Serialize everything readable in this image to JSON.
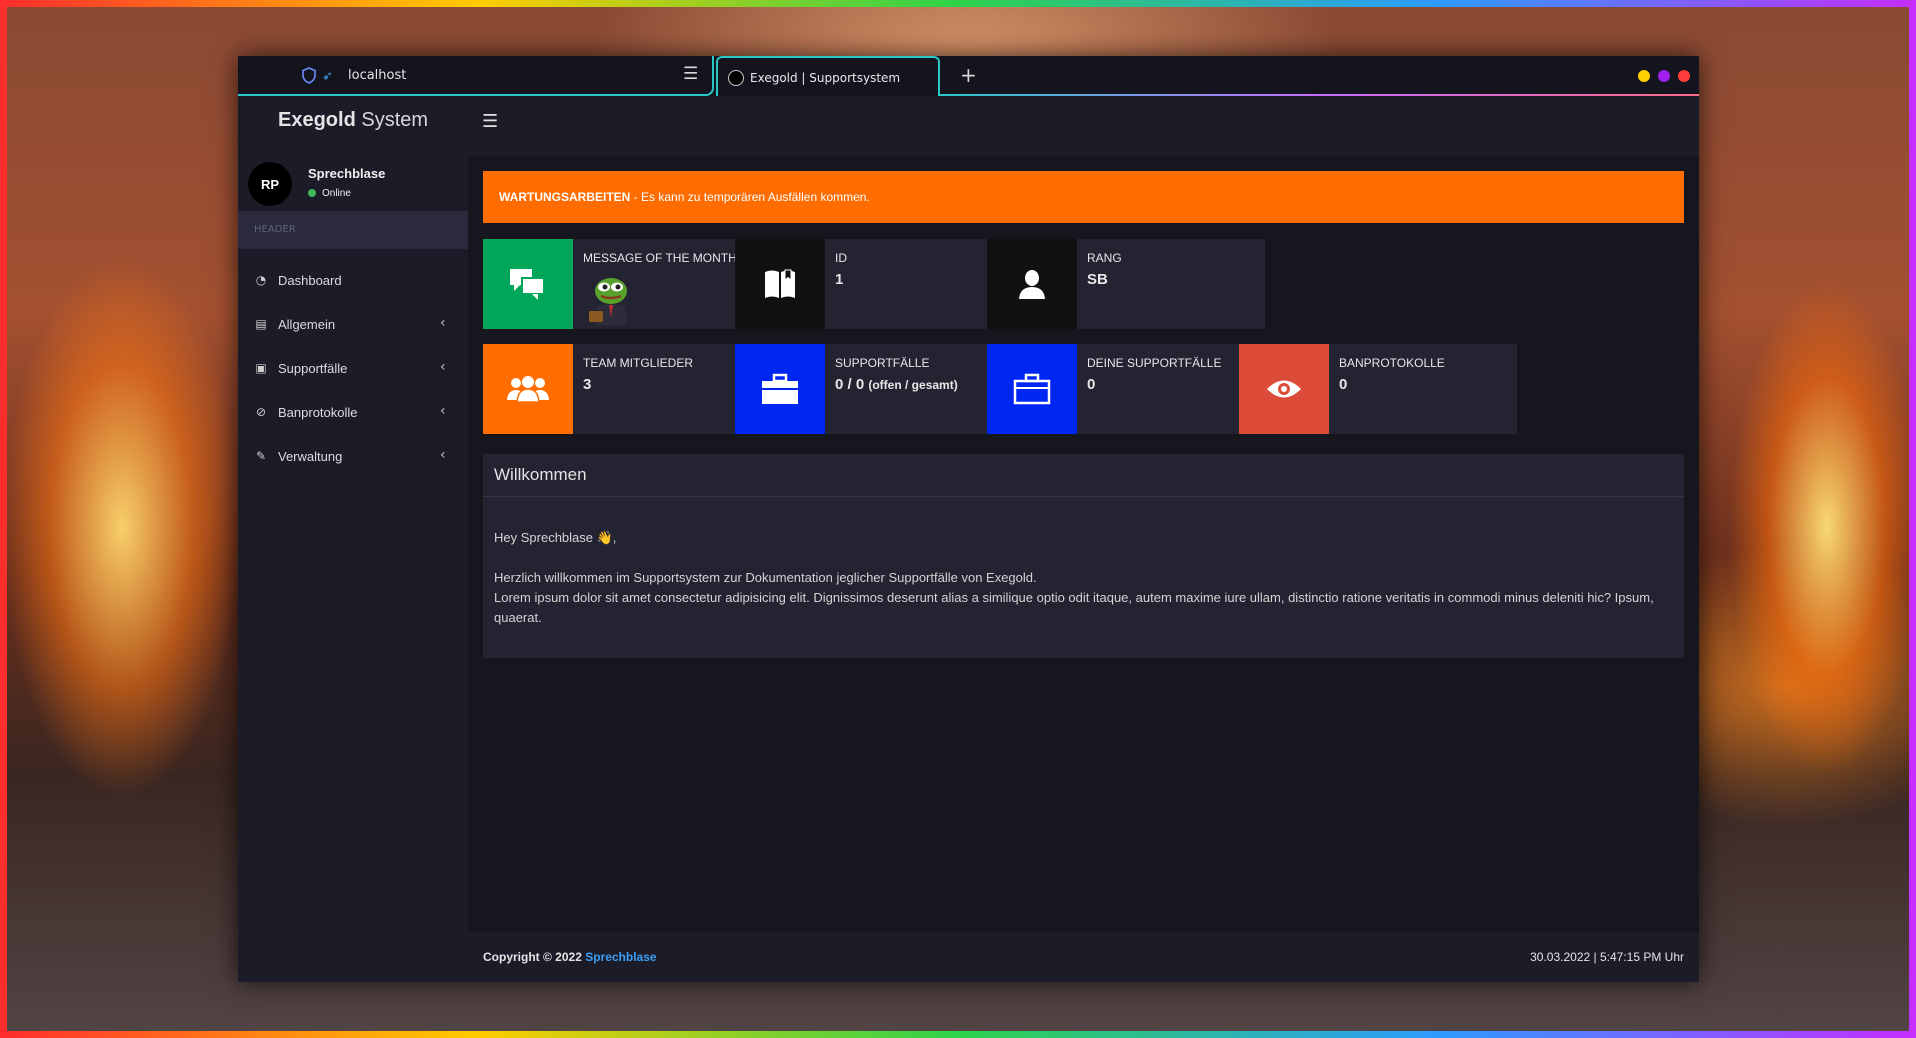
{
  "browser": {
    "url": "localhost",
    "tab_title": "Exegold | Supportsystem",
    "window_dots": [
      "#ffd000",
      "#a020f0",
      "#ff3b3b"
    ]
  },
  "app": {
    "brand_bold": "Exegold",
    "brand_rest": "System"
  },
  "user": {
    "initials": "RP",
    "name": "Sprechblase",
    "status": "Online"
  },
  "sidebar": {
    "header": "HEADER",
    "items": [
      {
        "label": "Dashboard",
        "icon": "dashboard-icon",
        "has_submenu": false
      },
      {
        "label": "Allgemein",
        "icon": "book-icon",
        "has_submenu": true
      },
      {
        "label": "Supportfälle",
        "icon": "briefcase-icon",
        "has_submenu": true
      },
      {
        "label": "Banprotokolle",
        "icon": "ban-icon",
        "has_submenu": true
      },
      {
        "label": "Verwaltung",
        "icon": "pencil-icon",
        "has_submenu": true
      }
    ]
  },
  "alert": {
    "title": "WARTUNGSARBEITEN",
    "text": " - Es kann zu temporären Ausfällen kommen.",
    "color": "#ff6d00"
  },
  "info_boxes": [
    {
      "label": "MESSAGE OF THE MONTH",
      "value": "",
      "icon": "chat-bubbles-icon",
      "color": "#00a65a"
    },
    {
      "label": "ID",
      "value": "1",
      "icon": "bookmark-book-icon",
      "color": "#111111"
    },
    {
      "label": "RANG",
      "value": "SB",
      "icon": "user-icon",
      "color": "#111111"
    },
    {
      "label": "TEAM MITGLIEDER",
      "value": "3",
      "icon": "users-icon",
      "color": "#ff6d00"
    },
    {
      "label": "SUPPORTFÄLLE",
      "value": "0 / 0",
      "value_suffix": "(offen / gesamt)",
      "icon": "briefcase-icon",
      "color": "#0026f2"
    },
    {
      "label": "DEINE SUPPORTFÄLLE",
      "value": "0",
      "icon": "briefcase-outline-icon",
      "color": "#0026f2"
    },
    {
      "label": "BANPROTOKOLLE",
      "value": "0",
      "icon": "eye-icon",
      "color": "#dd4b39"
    }
  ],
  "welcome": {
    "title": "Willkommen",
    "greeting": "Hey Sprechblase 👋,",
    "line1": "Herzlich willkommen im Supportsystem zur Dokumentation jeglicher Supportfälle von Exegold.",
    "line2": "Lorem ipsum dolor sit amet consectetur adipisicing elit. Dignissimos deserunt alias a similique optio odit itaque, autem maxime iure ullam, distinctio ratione veritatis in commodi minus deleniti hic? Ipsum, quaerat."
  },
  "footer": {
    "copyright": "Copyright © 2022 ",
    "owner": "Sprechblase",
    "timestamp": "30.03.2022 | 5:47:15 PM Uhr"
  }
}
